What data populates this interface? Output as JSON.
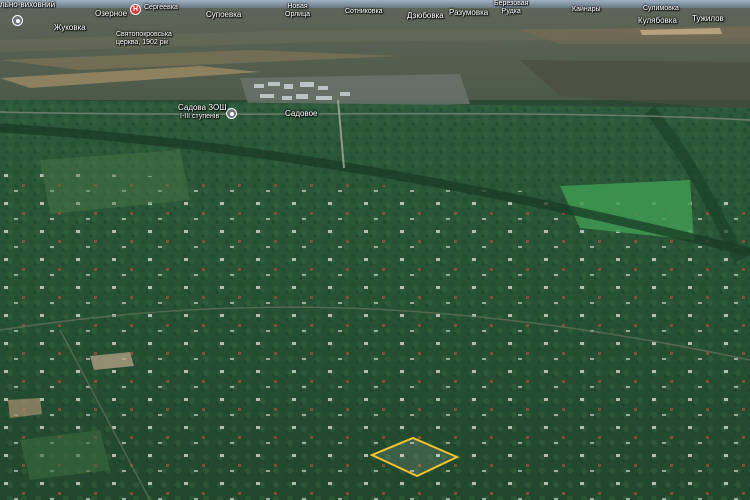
{
  "map": {
    "parcel_color": "#f2c230",
    "pins": [
      {
        "id": "ozerne-poi",
        "kind": "location-pin-icon"
      },
      {
        "id": "hospital",
        "kind": "hospital-pin-icon",
        "glyph": "H"
      },
      {
        "id": "school",
        "kind": "location-pin-icon"
      }
    ],
    "labels": {
      "top_left_cut": "льно-виховний",
      "zhukovka": "Жуковка",
      "ozernoe": "Озерное",
      "sergeevka": "Сергеевка",
      "church_1": "Святопокровська",
      "church_2": "церква, 1902 рік",
      "supoevka": "Супоевка",
      "novaya_1": "Новая",
      "novaya_2": "Орлица",
      "sotnikovka": "Сотниковка",
      "dzhobovka": "Дзюбовка",
      "razumovka": "Разумовка",
      "berezovaya_1": "Березовая",
      "berezovaya_2": "Рудка",
      "kainary": "Кайнары",
      "sulimovka": "Сулимовка",
      "kulyabovka": "Кулябовка",
      "tuzhilov": "Тужилов",
      "school_1": "Садова ЗОШ",
      "school_2": "I-III ступенів",
      "sadovoe": "Садовое"
    }
  }
}
